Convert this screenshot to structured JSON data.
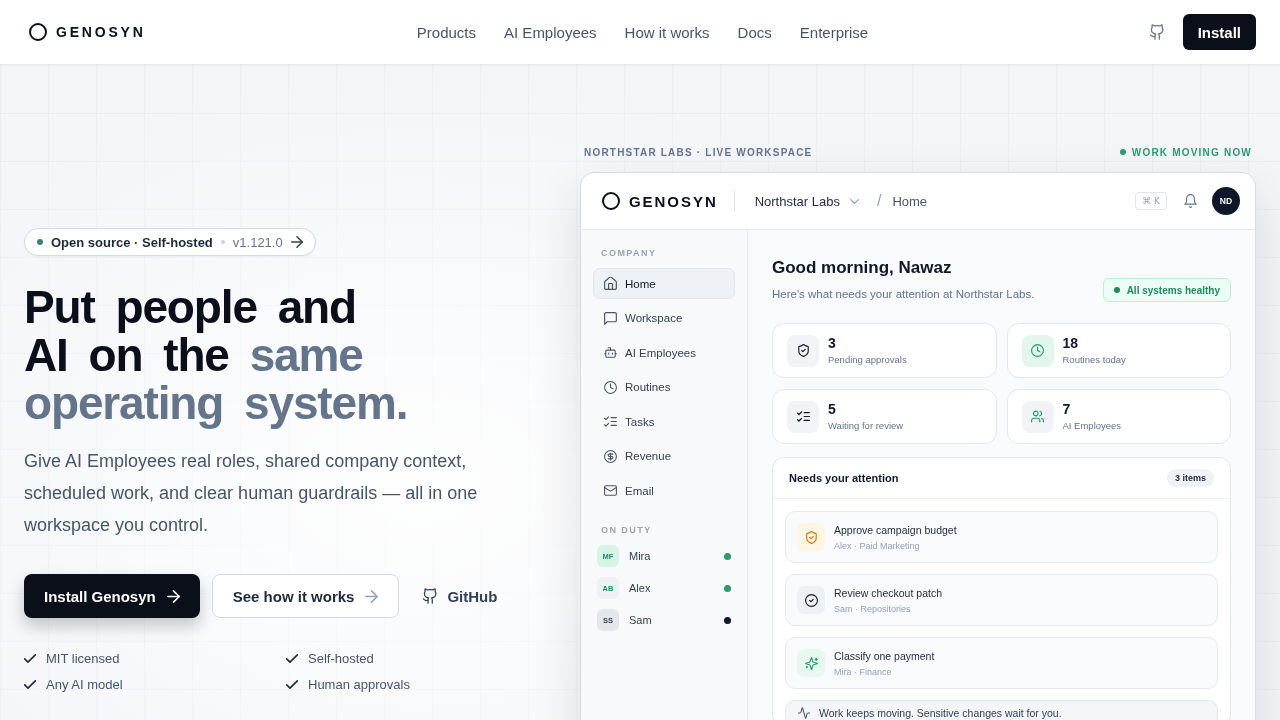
{
  "nav": {
    "brand": "GENOSYN",
    "links": [
      "Products",
      "AI Employees",
      "How it works",
      "Docs",
      "Enterprise"
    ],
    "cta": "Install"
  },
  "hero": {
    "badge": {
      "label": "Open source · Self-hosted",
      "version": "v1.121.0"
    },
    "heading": {
      "lead": "Put people and AI on the",
      "accent": "same operating system."
    },
    "description": "Give AI Employees real roles, shared company context, scheduled work, and clear human guardrails — all in one workspace you control.",
    "actions": [
      {
        "kind": "primary",
        "label": "Install Genosyn"
      },
      {
        "kind": "secondary",
        "label": "See how it works"
      },
      {
        "kind": "link",
        "label": "GitHub"
      }
    ],
    "features": [
      "MIT licensed",
      "Self-hosted",
      "Any AI model",
      "Human approvals"
    ]
  },
  "preview": {
    "caption": "NORTHSTAR LABS · LIVE WORKSPACE",
    "status": "WORK MOVING NOW",
    "app": {
      "brand": "GENOSYN",
      "workspace": "Northstar Labs",
      "crumb_separator": "/",
      "breadcrumb": "Home",
      "shortcut": "⌘ K",
      "user_initials": "ND",
      "sidebar": {
        "section": "COMPANY",
        "items": [
          {
            "label": "Home",
            "selected": true
          },
          {
            "label": "Workspace",
            "selected": false
          },
          {
            "label": "AI Employees",
            "selected": false
          },
          {
            "label": "Routines",
            "selected": false
          },
          {
            "label": "Tasks",
            "selected": false
          },
          {
            "label": "Revenue",
            "selected": false
          },
          {
            "label": "Email",
            "selected": false
          }
        ],
        "duty_title": "ON DUTY",
        "people": [
          {
            "name": "Mira",
            "kind": "ai",
            "avatar": {
              "initials": "MF",
              "color": "#d6f5e7"
            },
            "color": "#2a9d6f"
          },
          {
            "name": "Alex",
            "kind": "ai",
            "avatar": {
              "initials": "AB",
              "color": "#eef1f4"
            },
            "color": "#2a9d6f"
          },
          {
            "name": "Sam",
            "kind": "human",
            "avatar": {
              "initials": "SS",
              "color": "#e3e6ea"
            },
            "color": "#0f172a"
          }
        ]
      },
      "main": {
        "greeting": "Good morning, Nawaz",
        "subtitle": "Here's what needs your attention at Northstar Labs.",
        "health": "All systems healthy",
        "stats": [
          {
            "value": "3",
            "label": "Pending approvals",
            "color": "#f1f3f6"
          },
          {
            "value": "18",
            "label": "Routines today",
            "color": "#e3f6ee"
          },
          {
            "value": "5",
            "label": "Waiting for review",
            "color": "#f1f3f6"
          },
          {
            "value": "7",
            "label": "AI Employees",
            "color": "#f1f3f6"
          }
        ],
        "attention": {
          "title": "Needs your attention",
          "count": "3 items",
          "items": [
            {
              "title": "Approve campaign budget",
              "meta": "Alex · Paid Marketing",
              "color": "#fdf6e4"
            },
            {
              "title": "Review checkout patch",
              "meta": "Sam · Repositories",
              "color": "#eef1f4"
            },
            {
              "title": "Classify one payment",
              "meta": "Mira · Finance",
              "color": "#e7f8f0"
            }
          ]
        },
        "note": "Work keeps moving. Sensitive changes wait for you."
      }
    }
  }
}
